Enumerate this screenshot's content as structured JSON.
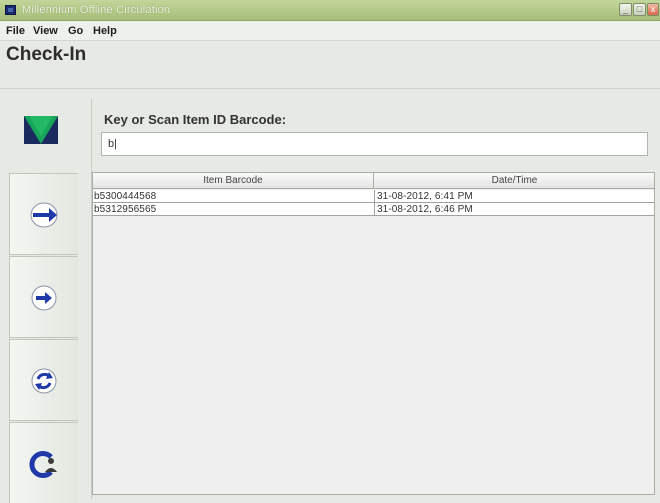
{
  "window": {
    "title": "Millennium Offline Circulation",
    "min_glyph": "_",
    "max_glyph": "□",
    "close_glyph": "x"
  },
  "menu": {
    "file": "File",
    "view": "View",
    "go": "Go",
    "help": "Help"
  },
  "page": {
    "heading": "Check-In"
  },
  "checkin": {
    "prompt_label": "Key or Scan Item ID Barcode:",
    "input_value": "b|"
  },
  "table": {
    "headers": [
      "Item Barcode",
      "Date/Time"
    ],
    "rows": [
      [
        "b5300444568",
        "31-08-2012, 6:41 PM"
      ],
      [
        "b5312956565",
        "31-08-2012, 6:46 PM"
      ]
    ]
  },
  "sidebar": {
    "logo": "triangle-logo-icon",
    "buttons": [
      {
        "icon": "check-out-arrow-icon"
      },
      {
        "icon": "check-in-arrow-icon"
      },
      {
        "icon": "renew-cycle-icon"
      },
      {
        "icon": "patron-icon"
      }
    ]
  },
  "colors": {
    "titlebar": "#a7bf79",
    "accent_blue": "#1f3aa8",
    "logo_green": "#18a35a",
    "logo_navy": "#1b2a5e"
  }
}
